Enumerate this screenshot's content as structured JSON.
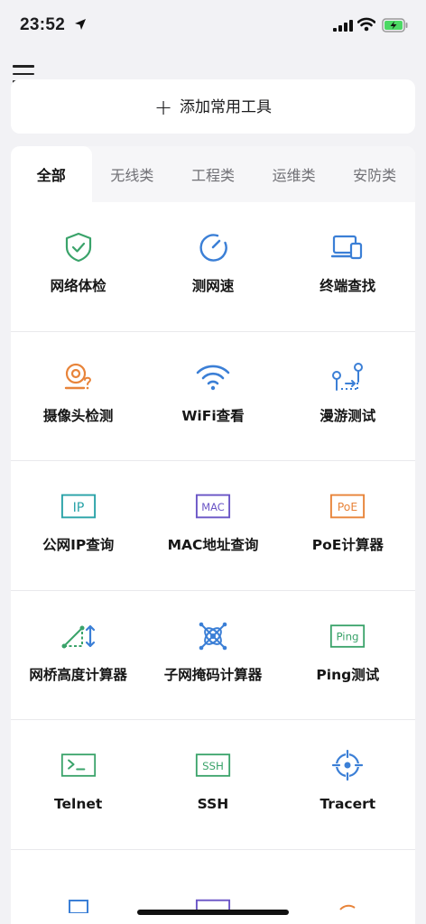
{
  "status_bar": {
    "time": "23:52"
  },
  "add_tool": {
    "plus": "+",
    "label": "添加常用工具"
  },
  "tabs": [
    {
      "label": "全部"
    },
    {
      "label": "无线类"
    },
    {
      "label": "工程类"
    },
    {
      "label": "运维类"
    },
    {
      "label": "安防类"
    }
  ],
  "tools": [
    {
      "label": "网络体检",
      "icon": "shield-check-icon",
      "color": "#3aa36a"
    },
    {
      "label": "测网速",
      "icon": "speedometer-icon",
      "color": "#3b7fd6"
    },
    {
      "label": "终端查找",
      "icon": "device-search-icon",
      "color": "#3b7fd6"
    },
    {
      "label": "摄像头检测",
      "icon": "camera-question-icon",
      "color": "#e8843a"
    },
    {
      "label": "WiFi查看",
      "icon": "wifi-icon",
      "color": "#3b7fd6"
    },
    {
      "label": "漫游测试",
      "icon": "roaming-icon",
      "color": "#3b7fd6"
    },
    {
      "label": "公网IP查询",
      "icon": "ip-icon",
      "color": "#2aa3a8"
    },
    {
      "label": "MAC地址查询",
      "icon": "mac-icon",
      "color": "#6a55c6"
    },
    {
      "label": "PoE计算器",
      "icon": "poe-icon",
      "color": "#e8843a"
    },
    {
      "label": "网桥高度计算器",
      "icon": "bridge-height-icon",
      "color": "#3aa36a"
    },
    {
      "label": "子网掩码计算器",
      "icon": "subnet-mask-icon",
      "color": "#3b7fd6"
    },
    {
      "label": "Ping测试",
      "icon": "ping-icon",
      "color": "#3aa36a"
    },
    {
      "label": "Telnet",
      "icon": "terminal-icon",
      "color": "#3aa36a"
    },
    {
      "label": "SSH",
      "icon": "ssh-icon",
      "color": "#3aa36a"
    },
    {
      "label": "Tracert",
      "icon": "crosshair-icon",
      "color": "#3b7fd6"
    }
  ],
  "icon_text": {
    "ip": "IP",
    "mac": "MAC",
    "poe": "PoE",
    "ping": "Ping",
    "ssh": "SSH"
  }
}
